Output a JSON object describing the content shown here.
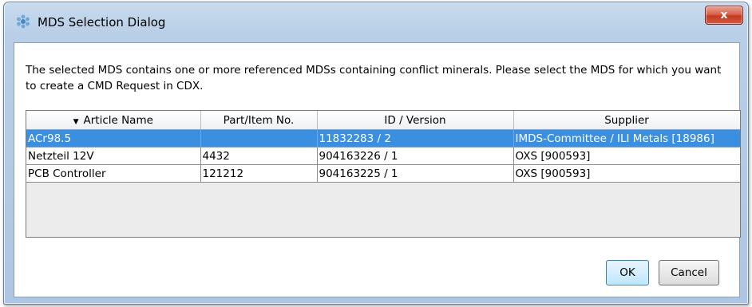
{
  "window": {
    "title": "MDS Selection Dialog",
    "close_label": "x"
  },
  "message": "The selected MDS contains one or more referenced MDSs containing conflict minerals. Please select the MDS for which you want to create a CMD Request in CDX.",
  "table": {
    "sort_indicator": "▼",
    "columns": [
      "Article Name",
      "Part/Item No.",
      "ID / Version",
      "Supplier"
    ],
    "rows": [
      {
        "article": "ACr98.5",
        "part": "",
        "id_version": "11832283 / 2",
        "supplier": "IMDS-Committee / ILI Metals [18986]",
        "selected": true
      },
      {
        "article": "Netzteil 12V",
        "part": "4432",
        "id_version": "904163226 / 1",
        "supplier": "OXS [900593]",
        "selected": false
      },
      {
        "article": "PCB Controller",
        "part": "121212",
        "id_version": "904163225 / 1",
        "supplier": "OXS [900593]",
        "selected": false
      }
    ]
  },
  "buttons": {
    "ok": "OK",
    "cancel": "Cancel"
  },
  "colors": {
    "selection": "#3a8fe0",
    "title_bar": "#b9cfe7"
  }
}
